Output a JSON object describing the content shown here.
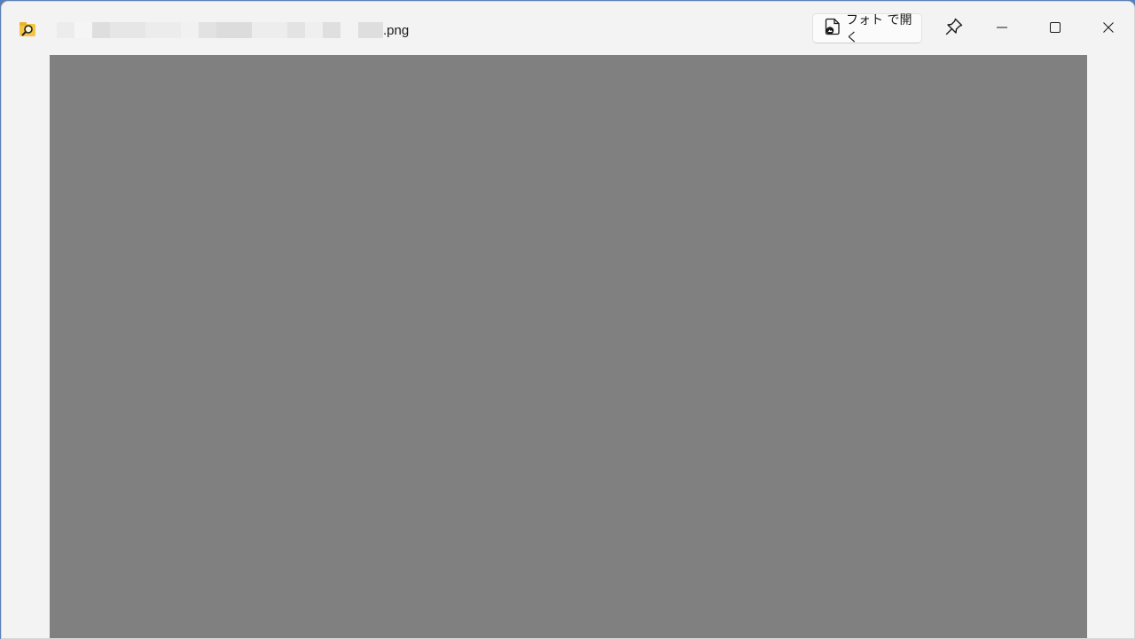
{
  "window": {
    "title_visible_suffix": ".png",
    "title_redacted": true
  },
  "toolbar": {
    "open_with_label": "フォト で開く",
    "open_with_icon": "photos-doc-icon",
    "pin_icon": "pin-icon",
    "minimize_icon": "minimize-icon",
    "maximize_icon": "maximize-icon",
    "close_icon": "close-icon"
  },
  "preview": {
    "background_color": "#808080"
  },
  "colors": {
    "titlebar_bg": "#f3f3f3",
    "desktop_accent": "#5a7fb8"
  }
}
